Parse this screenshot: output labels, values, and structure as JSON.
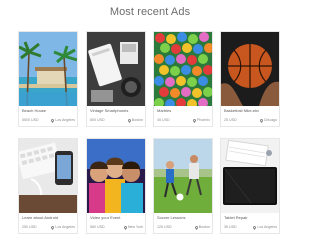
{
  "page": {
    "title": "Most recent Ads"
  },
  "ads": [
    {
      "name": "Beach House",
      "price": "5500 USD",
      "location": "Los Angeles",
      "icon": "map-pin-icon"
    },
    {
      "name": "Vintage Smartphones",
      "price": "800 USD",
      "location": "Boston",
      "icon": "map-pin-icon"
    },
    {
      "name": "Marbles",
      "price": "45 USD",
      "location": "Phoenix",
      "icon": "map-pin-icon"
    },
    {
      "name": "Basketball Nike-ekv",
      "price": "25 USD",
      "location": "Chicago",
      "icon": "map-pin-icon"
    },
    {
      "name": "Learn about Android",
      "price": "250 USD",
      "location": "Los Angeles",
      "icon": "map-pin-icon"
    },
    {
      "name": "Video your Event",
      "price": "560 USD",
      "location": "New York",
      "icon": "map-pin-icon"
    },
    {
      "name": "Soccer Lessons",
      "price": "125 USD",
      "location": "Boston",
      "icon": "map-pin-icon"
    },
    {
      "name": "Tablet Repair",
      "price": "35 USD",
      "location": "Los Angeles",
      "icon": "map-pin-icon"
    }
  ]
}
